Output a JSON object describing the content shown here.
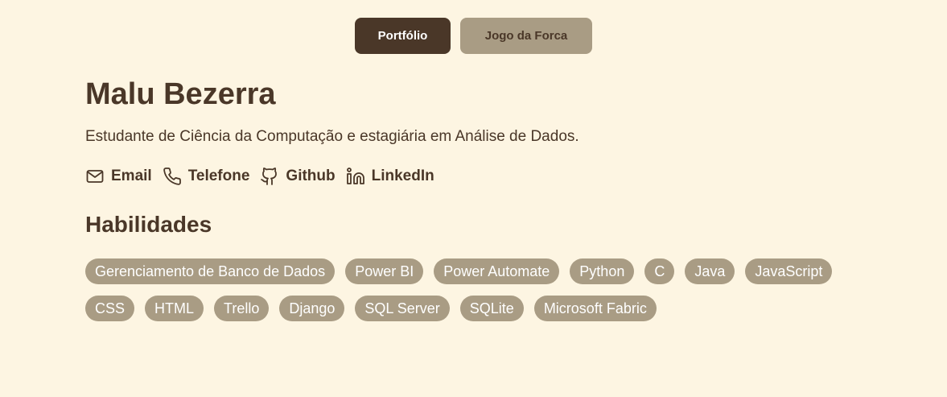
{
  "nav": {
    "portfolio_label": "Portfólio",
    "hangman_label": "Jogo da Forca"
  },
  "profile": {
    "name": "Malu Bezerra",
    "description": "Estudante de Ciência da Computação e estagiária em Análise de Dados."
  },
  "contacts": [
    {
      "label": "Email",
      "icon": "mail-icon"
    },
    {
      "label": "Telefone",
      "icon": "phone-icon"
    },
    {
      "label": "Github",
      "icon": "github-icon"
    },
    {
      "label": "LinkedIn",
      "icon": "linkedin-icon"
    }
  ],
  "skills": {
    "title": "Habilidades",
    "items": [
      "Gerenciamento de Banco de Dados",
      "Power BI",
      "Power Automate",
      "Python",
      "C",
      "Java",
      "JavaScript",
      "CSS",
      "HTML",
      "Trello",
      "Django",
      "SQL Server",
      "SQLite",
      "Microsoft Fabric"
    ]
  },
  "colors": {
    "background": "#fdf5e2",
    "primary": "#4a3728",
    "tag": "#a99c84"
  }
}
